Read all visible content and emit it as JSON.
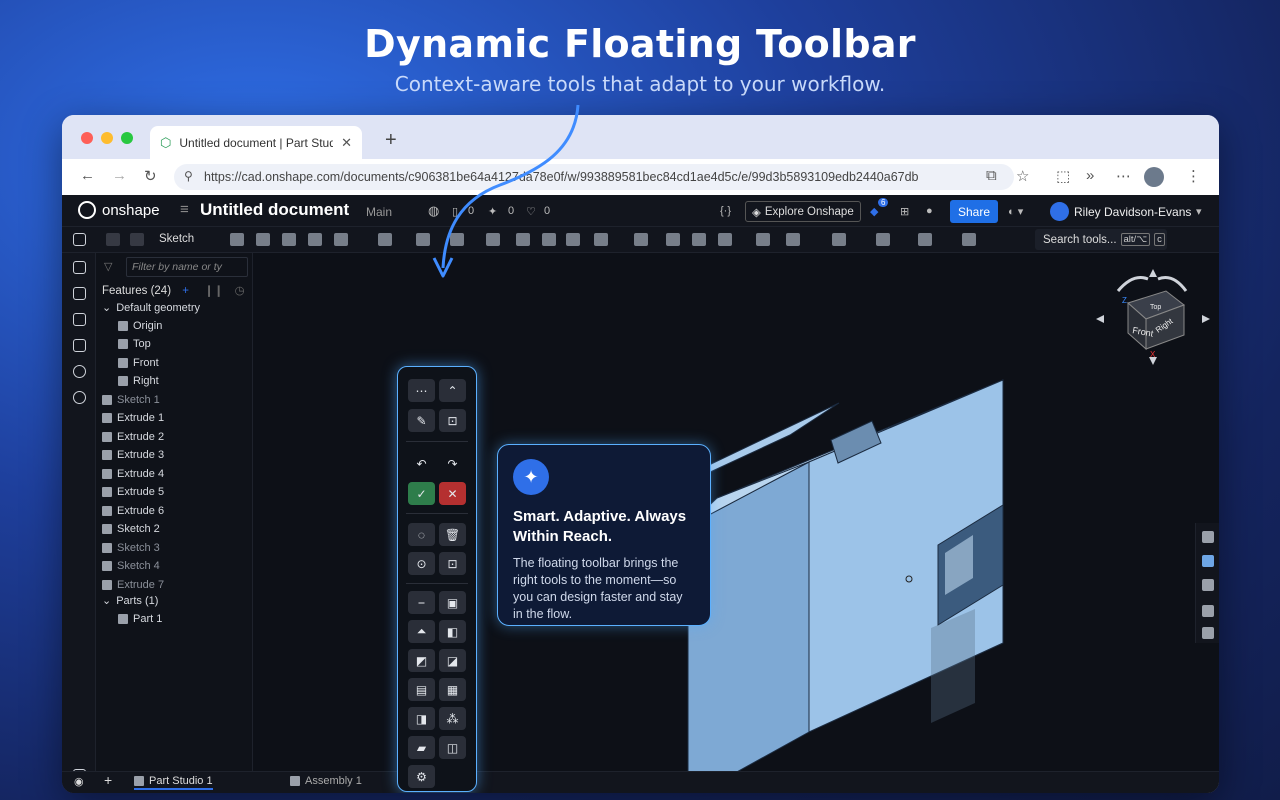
{
  "hero": {
    "title": "Dynamic Floating Toolbar",
    "subtitle": "Context-aware tools that adapt to your workflow."
  },
  "browser": {
    "tab_title": "Untitled document | Part Studio 1",
    "url": "https://cad.onshape.com/documents/c906381be64a4127da78e0f/w/993889581bec84cd1ae4d5c/e/99d3b5893109edb2440a67db"
  },
  "app": {
    "logo_text": "onshape",
    "document_title": "Untitled document",
    "branch": "Main",
    "counts": {
      "versions": "0",
      "likes_a": "0",
      "likes_b": "0"
    },
    "explore_label": "Explore Onshape",
    "notification_count": "6",
    "share_label": "Share",
    "user_name": "Riley Davidson-Evans"
  },
  "toolbar": {
    "sketch_label": "Sketch",
    "search_label": "Search tools...",
    "search_shortcut": "alt/⌥",
    "search_key": "c"
  },
  "feature_panel": {
    "filter_placeholder": "Filter by name or ty",
    "header": "Features (24)",
    "items": [
      {
        "label": "Default geometry",
        "dim": false
      },
      {
        "label": "Origin",
        "dim": false
      },
      {
        "label": "Top",
        "dim": false
      },
      {
        "label": "Front",
        "dim": false
      },
      {
        "label": "Right",
        "dim": false
      },
      {
        "label": "Sketch 1",
        "dim": true
      },
      {
        "label": "Extrude 1",
        "dim": false
      },
      {
        "label": "Extrude 2",
        "dim": false
      },
      {
        "label": "Extrude 3",
        "dim": false
      },
      {
        "label": "Extrude 4",
        "dim": false
      },
      {
        "label": "Extrude 5",
        "dim": false
      },
      {
        "label": "Extrude 6",
        "dim": false
      },
      {
        "label": "Sketch 2",
        "dim": false
      },
      {
        "label": "Sketch 3",
        "dim": true
      },
      {
        "label": "Sketch 4",
        "dim": true
      },
      {
        "label": "Extrude 7",
        "dim": true
      }
    ],
    "parts_header": "Parts (1)",
    "parts": [
      "Part 1"
    ]
  },
  "bottom_tabs": [
    "Part Studio 1",
    "Assembly 1"
  ],
  "callout": {
    "title": "Smart. Adaptive. Always Within Reach.",
    "body": "The floating toolbar brings the right tools to the moment—so you can design faster and stay in the flow."
  },
  "view_cube": {
    "faces": [
      "Front",
      "Right",
      "Top"
    ],
    "axis_labels": [
      "Z",
      "X"
    ]
  },
  "colors": {
    "accent": "#2f6fe8",
    "glow": "#5bb0ff",
    "part": "#9cc3e8"
  }
}
